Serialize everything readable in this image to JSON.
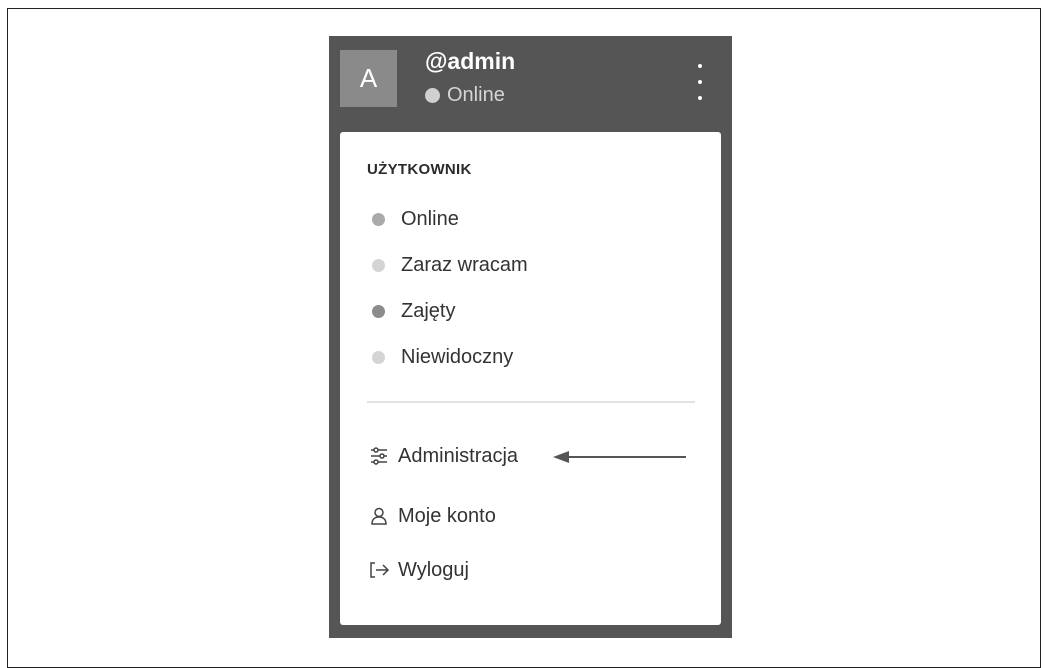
{
  "header": {
    "avatar_letter": "A",
    "username": "@admin",
    "status": "Online",
    "status_dot_color": "#d0d0d0"
  },
  "menu": {
    "section_title": "UŻYTKOWNIK",
    "statuses": [
      {
        "label": "Online",
        "color": "#aaaaaa"
      },
      {
        "label": "Zaraz wracam",
        "color": "#d4d4d4"
      },
      {
        "label": "Zajęty",
        "color": "#8c8c8c"
      },
      {
        "label": "Niewidoczny",
        "color": "#d4d4d4"
      }
    ],
    "actions": [
      {
        "label": "Administracja",
        "icon": "sliders-icon"
      },
      {
        "label": "Moje konto",
        "icon": "user-icon"
      },
      {
        "label": "Wyloguj",
        "icon": "logout-icon"
      }
    ]
  },
  "colors": {
    "panel_bg": "#555555",
    "menu_bg": "#ffffff",
    "arrow": "#555555"
  }
}
